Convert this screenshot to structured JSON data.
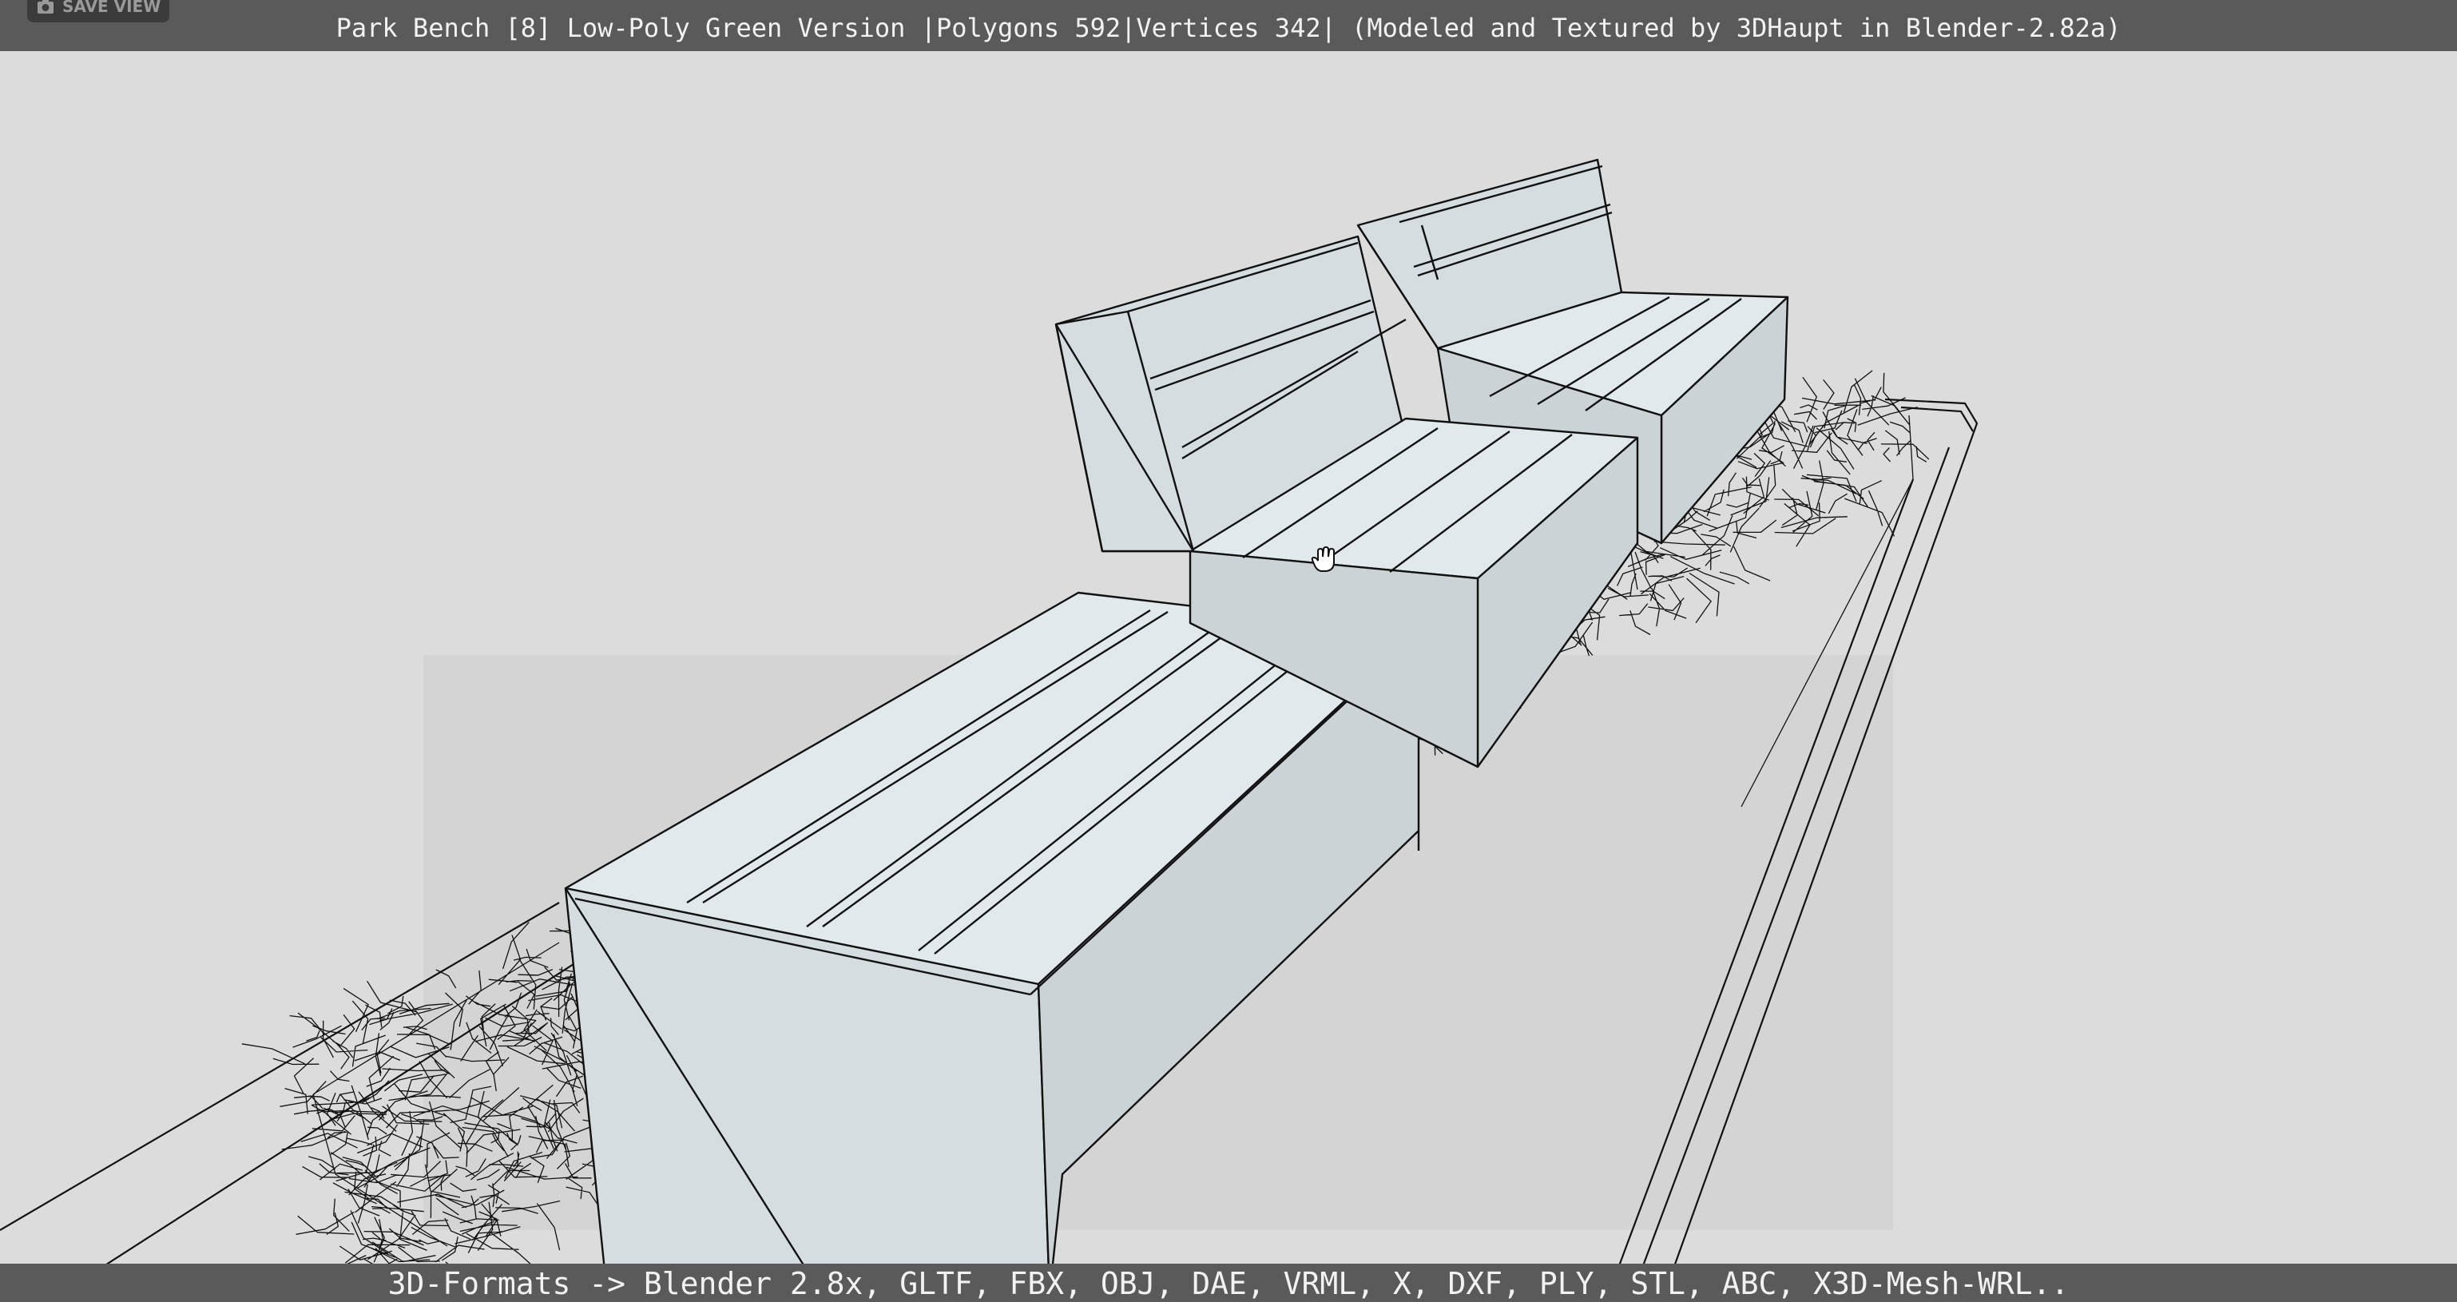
{
  "viewer": {
    "title": "Park Bench [8] Low-Poly Green Version |Polygons 592|Vertices 342| (Modeled and Textured by 3DHaupt in Blender-2.82a)",
    "save_view_label": "SAVE VIEW",
    "formats_text": "3D-Formats -> Blender 2.8x, GLTF, FBX, OBJ, DAE, VRML, X, DXF, PLY, STL, ABC, X3D-Mesh-WRL.."
  },
  "icons": {
    "save_view": "camera-icon",
    "cursor": "hand-cursor-icon"
  },
  "colors": {
    "background": "#dcdcdc",
    "bar": "#5a5a5a",
    "bench_fill": "#dfe6e9",
    "wire": "#111111",
    "bar_text": "#f2f2f2"
  }
}
